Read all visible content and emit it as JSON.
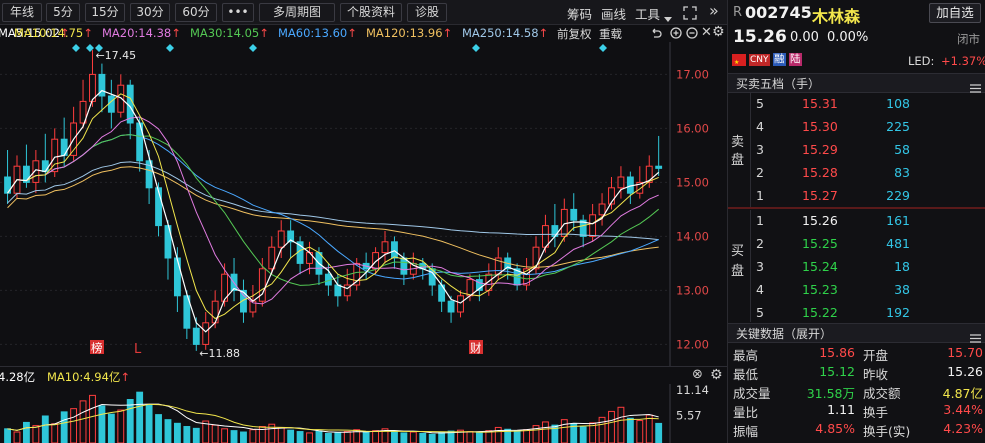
{
  "toolbar": {
    "period_buttons": [
      "年线",
      "5分",
      "15分",
      "30分",
      "60分"
    ],
    "more": "•••",
    "multi_period": "多周期图",
    "stock_info": "个股资料",
    "diagnose": "诊股",
    "right_links": [
      "筹码",
      "画线",
      "工具"
    ],
    "collapse_glyph": "»"
  },
  "ma_row": {
    "ma5": "MA5:15.02",
    "ma10": "MA10:14.75",
    "ma20": "MA20:14.38",
    "ma30": "MA30:14.05",
    "ma60": "MA60:13.60",
    "ma120": "MA120:13.96",
    "ma250": "MA250:14.58",
    "fq": "前复权",
    "overlay": "重载",
    "up_arrow": "↑"
  },
  "chart_labels": {
    "high_marker": "←17.45",
    "low_marker": "←11.88",
    "badge_bang": "榜",
    "badge_L": "L",
    "badge_cai": "财"
  },
  "chart_data": {
    "type": "candlestick",
    "y_ticks": [
      "17.00",
      "16.00",
      "15.00",
      "14.00",
      "13.00",
      "12.00"
    ],
    "ylim": [
      11.6,
      17.6
    ],
    "high": 17.45,
    "low": 11.88,
    "candles": [
      [
        15.1,
        14.8,
        15.6,
        14.6
      ],
      [
        14.8,
        15.3,
        15.5,
        14.7
      ],
      [
        15.3,
        15.0,
        15.7,
        14.9
      ],
      [
        15.0,
        15.4,
        15.6,
        14.8
      ],
      [
        15.4,
        15.2,
        15.9,
        15.0
      ],
      [
        15.2,
        15.8,
        16.0,
        15.1
      ],
      [
        15.8,
        15.5,
        16.2,
        15.3
      ],
      [
        15.5,
        16.1,
        16.4,
        15.4
      ],
      [
        16.1,
        16.5,
        16.9,
        16.0
      ],
      [
        16.5,
        17.0,
        17.45,
        16.4
      ],
      [
        17.0,
        16.6,
        17.2,
        16.3
      ],
      [
        16.6,
        16.3,
        16.9,
        16.0
      ],
      [
        16.3,
        16.8,
        17.0,
        16.2
      ],
      [
        16.8,
        16.1,
        16.9,
        15.8
      ],
      [
        16.1,
        15.4,
        16.2,
        15.2
      ],
      [
        15.4,
        14.9,
        15.6,
        14.6
      ],
      [
        14.9,
        14.2,
        15.0,
        14.0
      ],
      [
        14.2,
        13.6,
        14.3,
        13.2
      ],
      [
        13.6,
        12.9,
        13.8,
        12.6
      ],
      [
        12.9,
        12.3,
        13.0,
        12.1
      ],
      [
        12.3,
        12.0,
        12.5,
        11.88
      ],
      [
        12.0,
        12.4,
        12.6,
        11.9
      ],
      [
        12.4,
        12.8,
        13.0,
        12.3
      ],
      [
        12.8,
        13.3,
        13.5,
        12.7
      ],
      [
        13.3,
        13.0,
        13.6,
        12.8
      ],
      [
        13.0,
        12.6,
        13.2,
        12.4
      ],
      [
        12.6,
        12.8,
        13.1,
        12.5
      ],
      [
        12.8,
        13.4,
        13.6,
        12.7
      ],
      [
        13.4,
        13.8,
        14.0,
        13.3
      ],
      [
        13.8,
        14.1,
        14.3,
        13.6
      ],
      [
        14.1,
        13.9,
        14.3,
        13.6
      ],
      [
        13.9,
        13.5,
        14.0,
        13.3
      ],
      [
        13.5,
        13.7,
        13.9,
        13.3
      ],
      [
        13.7,
        13.3,
        13.8,
        13.1
      ],
      [
        13.3,
        13.1,
        13.5,
        12.9
      ],
      [
        13.1,
        12.9,
        13.3,
        12.7
      ],
      [
        12.9,
        13.1,
        13.4,
        12.8
      ],
      [
        13.1,
        13.5,
        13.6,
        13.0
      ],
      [
        13.5,
        13.4,
        13.7,
        13.2
      ],
      [
        13.4,
        13.7,
        13.8,
        13.3
      ],
      [
        13.7,
        13.9,
        14.1,
        13.5
      ],
      [
        13.9,
        13.6,
        14.0,
        13.4
      ],
      [
        13.6,
        13.3,
        13.7,
        13.1
      ],
      [
        13.3,
        13.5,
        13.7,
        13.2
      ],
      [
        13.5,
        13.4,
        13.6,
        13.2
      ],
      [
        13.4,
        13.1,
        13.5,
        12.9
      ],
      [
        13.1,
        12.8,
        13.2,
        12.6
      ],
      [
        12.8,
        12.6,
        12.9,
        12.4
      ],
      [
        12.6,
        12.9,
        13.0,
        12.5
      ],
      [
        12.9,
        13.2,
        13.3,
        12.8
      ],
      [
        13.2,
        13.0,
        13.3,
        12.8
      ],
      [
        13.0,
        13.3,
        13.5,
        12.9
      ],
      [
        13.3,
        13.6,
        13.8,
        13.2
      ],
      [
        13.6,
        13.4,
        13.7,
        13.2
      ],
      [
        13.4,
        13.1,
        13.5,
        13.0
      ],
      [
        13.1,
        13.4,
        13.6,
        13.0
      ],
      [
        13.4,
        13.8,
        14.0,
        13.3
      ],
      [
        13.8,
        14.2,
        14.4,
        13.7
      ],
      [
        14.2,
        14.0,
        14.6,
        13.8
      ],
      [
        14.0,
        14.5,
        14.7,
        13.9
      ],
      [
        14.5,
        14.3,
        14.8,
        14.1
      ],
      [
        14.3,
        14.0,
        14.4,
        13.8
      ],
      [
        14.0,
        14.4,
        14.6,
        13.9
      ],
      [
        14.4,
        14.6,
        14.8,
        14.2
      ],
      [
        14.6,
        14.9,
        15.1,
        14.5
      ],
      [
        14.9,
        15.1,
        15.3,
        14.7
      ],
      [
        15.1,
        14.8,
        15.2,
        14.6
      ],
      [
        14.8,
        15.0,
        15.3,
        14.7
      ],
      [
        15.0,
        15.3,
        15.5,
        14.9
      ],
      [
        15.3,
        15.26,
        15.86,
        15.12
      ]
    ],
    "ma_colors": {
      "ma5": "#ffffff",
      "ma10": "#f2e64c",
      "ma20": "#e07be0",
      "ma30": "#54c854",
      "ma60": "#4aa8ff",
      "ma120": "#f0c060",
      "ma250": "#a0c8e8"
    }
  },
  "volume": {
    "vol_label": "4.28亿",
    "ma10_label": "MA10:4.94亿",
    "arrow": "↑",
    "y_ticks": [
      "11.14",
      "5.57"
    ],
    "bars": [
      3.1,
      2.4,
      4.5,
      3.8,
      5.9,
      4.2,
      6.8,
      7.5,
      9.2,
      10.4,
      8.1,
      6.3,
      7.2,
      9.5,
      11.1,
      8.4,
      6.2,
      5.1,
      4.3,
      3.6,
      3.2,
      4.8,
      3.9,
      3.1,
      2.7,
      2.4,
      2.9,
      3.6,
      4.1,
      3.3,
      2.8,
      2.5,
      2.2,
      2.6,
      2.1,
      2.3,
      2.5,
      2.9,
      2.4,
      2.7,
      3.1,
      2.6,
      2.2,
      2.4,
      2.1,
      1.9,
      2.3,
      2.6,
      2.8,
      2.5,
      2.2,
      2.7,
      3.4,
      3.0,
      2.6,
      2.9,
      3.8,
      4.6,
      3.9,
      5.1,
      4.2,
      3.5,
      4.4,
      5.6,
      6.9,
      7.8,
      5.4,
      4.9,
      6.1,
      4.28
    ]
  },
  "stock": {
    "r_mark": "R",
    "code": "002745",
    "name": "木林森",
    "add_watch": "加自选",
    "price": "15.26",
    "change": "0.00",
    "change_pct": "0.00%",
    "status": "闭市",
    "tag_cny": "CNY",
    "tag_rong": "融",
    "tag_lu": "陆",
    "led_label": "LED:",
    "led_value": "+1.37%"
  },
  "order_book": {
    "title": "买卖五档（手）",
    "sell_label": [
      "卖",
      "盘"
    ],
    "buy_label": [
      "买",
      "盘"
    ],
    "sells": [
      {
        "level": "5",
        "price": "15.31",
        "vol": "108"
      },
      {
        "level": "4",
        "price": "15.30",
        "vol": "225"
      },
      {
        "level": "3",
        "price": "15.29",
        "vol": "58"
      },
      {
        "level": "2",
        "price": "15.28",
        "vol": "83"
      },
      {
        "level": "1",
        "price": "15.27",
        "vol": "229"
      }
    ],
    "buys": [
      {
        "level": "1",
        "price": "15.26",
        "vol": "161"
      },
      {
        "level": "2",
        "price": "15.25",
        "vol": "481"
      },
      {
        "level": "3",
        "price": "15.24",
        "vol": "18"
      },
      {
        "level": "4",
        "price": "15.23",
        "vol": "38"
      },
      {
        "level": "5",
        "price": "15.22",
        "vol": "192"
      }
    ]
  },
  "key_data": {
    "title": "关键数据（展开）",
    "rows": [
      {
        "l1": "最高",
        "v1": "15.86",
        "l2": "开盘",
        "v2": "15.70"
      },
      {
        "l1": "最低",
        "v1": "15.12",
        "l2": "昨收",
        "v2": "15.26"
      },
      {
        "l1": "成交量",
        "v1": "31.58万",
        "l2": "成交额",
        "v2": "4.87亿"
      },
      {
        "l1": "量比",
        "v1": "1.11",
        "l2": "换手",
        "v2": "3.44%"
      },
      {
        "l1": "振幅",
        "v1": "4.85%",
        "l2": "换手(实)",
        "v2": "4.23%"
      }
    ]
  }
}
